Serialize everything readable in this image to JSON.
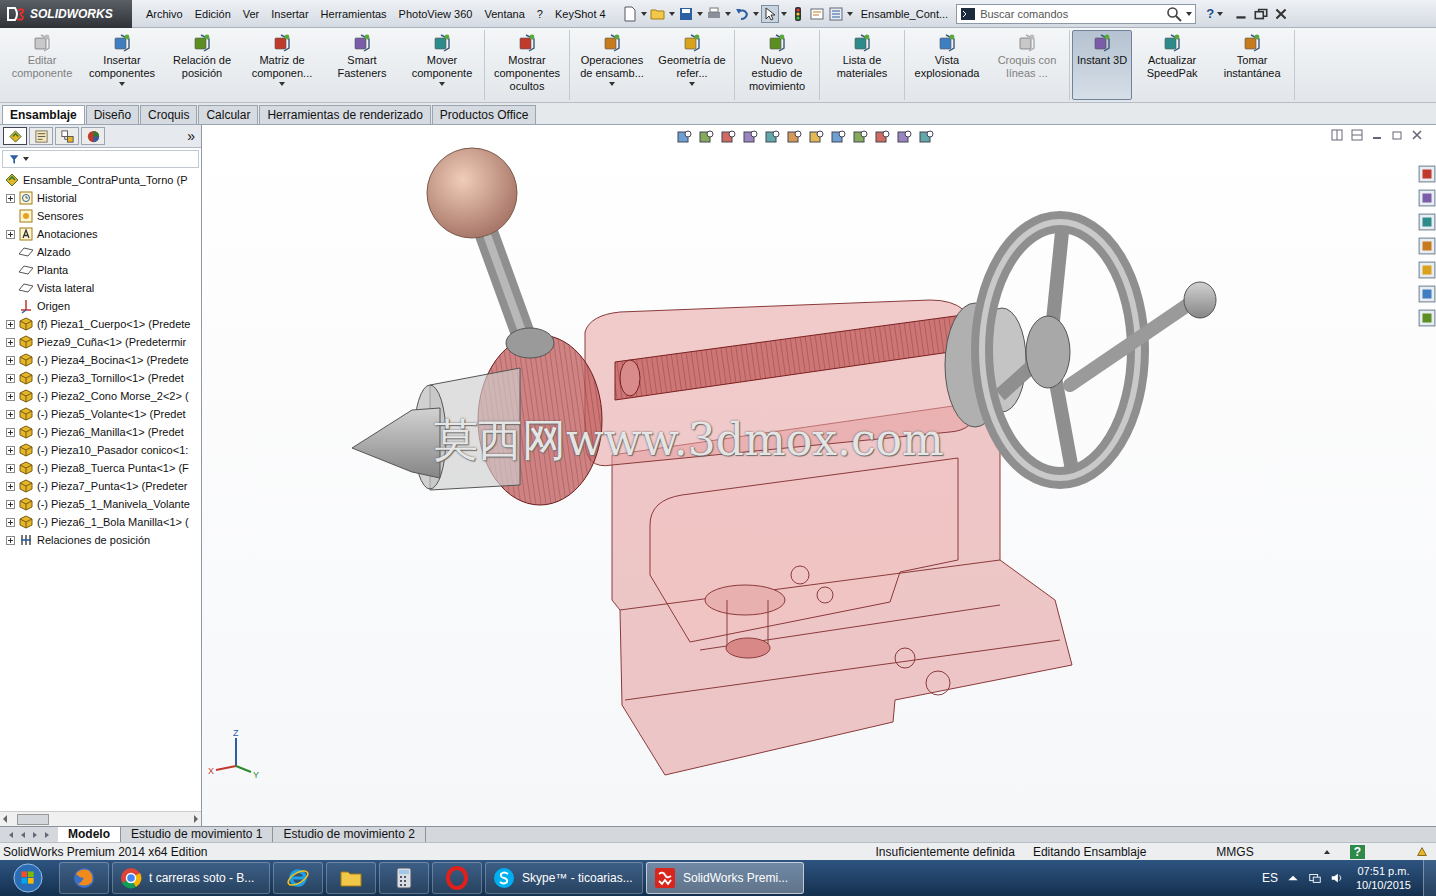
{
  "app": {
    "logo": "SOLIDWORKS",
    "document_title": "Ensamble_Cont...",
    "help": "?"
  },
  "menu": [
    "Archivo",
    "Edición",
    "Ver",
    "Insertar",
    "Herramientas",
    "PhotoView 360",
    "Ventana",
    "?",
    "KeyShot 4"
  ],
  "search": {
    "placeholder": "Buscar comandos"
  },
  "ribbon": [
    [
      {
        "label": "Editar componente",
        "disabled": true,
        "selected": false,
        "dropdown": false
      },
      {
        "label": "Insertar componentes",
        "disabled": false,
        "selected": false,
        "dropdown": true
      },
      {
        "label": "Relación de posición",
        "disabled": false,
        "selected": false,
        "dropdown": false
      },
      {
        "label": "Matriz de componen...",
        "disabled": false,
        "selected": false,
        "dropdown": true
      },
      {
        "label": "Smart Fasteners",
        "disabled": false,
        "selected": false,
        "dropdown": false
      },
      {
        "label": "Mover componente",
        "disabled": false,
        "selected": false,
        "dropdown": true
      }
    ],
    [
      {
        "label": "Mostrar componentes ocultos",
        "disabled": false,
        "selected": false,
        "dropdown": false
      }
    ],
    [
      {
        "label": "Operaciones de ensamb...",
        "disabled": false,
        "selected": false,
        "dropdown": true
      },
      {
        "label": "Geometría de refer...",
        "disabled": false,
        "selected": false,
        "dropdown": true
      }
    ],
    [
      {
        "label": "Nuevo estudio de movimiento",
        "disabled": false,
        "selected": false,
        "dropdown": false
      }
    ],
    [
      {
        "label": "Lista de materiales",
        "disabled": false,
        "selected": false,
        "dropdown": false
      }
    ],
    [
      {
        "label": "Vista explosionada",
        "disabled": false,
        "selected": false,
        "dropdown": false
      },
      {
        "label": "Croquis con líneas ...",
        "disabled": true,
        "selected": false,
        "dropdown": false
      }
    ],
    [
      {
        "label": "Instant 3D",
        "disabled": false,
        "selected": true,
        "dropdown": false
      },
      {
        "label": "Actualizar SpeedPak",
        "disabled": false,
        "selected": false,
        "dropdown": false
      },
      {
        "label": "Tomar instantánea",
        "disabled": false,
        "selected": false,
        "dropdown": false
      }
    ]
  ],
  "tabs": [
    {
      "label": "Ensamblaje",
      "selected": true
    },
    {
      "label": "Diseño",
      "selected": false
    },
    {
      "label": "Croquis",
      "selected": false
    },
    {
      "label": "Calcular",
      "selected": false
    },
    {
      "label": "Herramientas de renderizado",
      "selected": false
    },
    {
      "label": "Productos Office",
      "selected": false
    }
  ],
  "panel_tabs": [
    {
      "kind": "feature-tree",
      "selected": true
    },
    {
      "kind": "properties",
      "selected": false
    },
    {
      "kind": "configuration",
      "selected": false
    },
    {
      "kind": "display",
      "selected": false
    }
  ],
  "panel_more": "»",
  "tree": [
    {
      "text": "Ensamble_ContraPunta_Torno (P",
      "kind": "assembly",
      "expandable": false
    },
    {
      "text": "Historial",
      "kind": "history",
      "expandable": true
    },
    {
      "text": "Sensores",
      "kind": "sensors",
      "expandable": false
    },
    {
      "text": "Anotaciones",
      "kind": "annotations",
      "expandable": true
    },
    {
      "text": "Alzado",
      "kind": "plane",
      "expandable": false
    },
    {
      "text": "Planta",
      "kind": "plane",
      "expandable": false
    },
    {
      "text": "Vista lateral",
      "kind": "plane",
      "expandable": false
    },
    {
      "text": "Origen",
      "kind": "origin",
      "expandable": false
    },
    {
      "text": "(f) Pieza1_Cuerpo<1> (Predete",
      "kind": "part",
      "expandable": true
    },
    {
      "text": "Pieza9_Cuña<1> (Predetermir",
      "kind": "part",
      "expandable": true
    },
    {
      "text": "(-) Pieza4_Bocina<1> (Predete",
      "kind": "part",
      "expandable": true
    },
    {
      "text": "(-) Pieza3_Tornillo<1> (Predet",
      "kind": "part",
      "expandable": true
    },
    {
      "text": "(-) Pieza2_Cono Morse_2<2> (",
      "kind": "part",
      "expandable": true
    },
    {
      "text": "(-) Pieza5_Volante<1> (Predet",
      "kind": "part",
      "expandable": true
    },
    {
      "text": "(-) Pieza6_Manilla<1> (Predet",
      "kind": "part",
      "expandable": true
    },
    {
      "text": "(-) Pieza10_Pasador conico<1:",
      "kind": "part",
      "expandable": true
    },
    {
      "text": "(-) Pieza8_Tuerca Punta<1> (F",
      "kind": "part",
      "expandable": true
    },
    {
      "text": "(-) Pieza7_Punta<1> (Predeter",
      "kind": "part",
      "expandable": true
    },
    {
      "text": "(-) Pieza5_1_Manivela_Volante",
      "kind": "part",
      "expandable": true
    },
    {
      "text": "(-) Pieza6_1_Bola Manilla<1> (",
      "kind": "part",
      "expandable": true
    },
    {
      "text": "Relaciones de posición",
      "kind": "mates",
      "expandable": true
    }
  ],
  "watermark": "莫西网www.3dmox.com",
  "triad": [
    "Z",
    "X",
    "Y"
  ],
  "bottom_tabs": [
    {
      "label": "Modelo",
      "selected": true
    },
    {
      "label": "Estudio de movimiento 1",
      "selected": false
    },
    {
      "label": "Estudio de movimiento 2",
      "selected": false
    }
  ],
  "status_bar": {
    "product": "SolidWorks Premium 2014 x64 Edition",
    "state": "Insuficientemente definida",
    "mode": "Editando Ensamblaje",
    "units": "MMGS",
    "help": "?"
  },
  "taskbar": {
    "items": [
      {
        "kind": "firefox",
        "active": false
      },
      {
        "kind": "chrome",
        "label": "t carreras soto - B...",
        "active": false
      },
      {
        "kind": "ie",
        "active": false
      },
      {
        "kind": "explorer",
        "active": false
      },
      {
        "kind": "calculator",
        "active": false
      },
      {
        "kind": "opera",
        "active": false
      },
      {
        "kind": "skype",
        "label": "Skype™ - ticoarias...",
        "active": false
      },
      {
        "kind": "solidworks",
        "label": "SolidWorks Premi...",
        "active": true
      }
    ],
    "language": "ES",
    "time": "07:51 p.m.",
    "date": "10/10/2015"
  }
}
